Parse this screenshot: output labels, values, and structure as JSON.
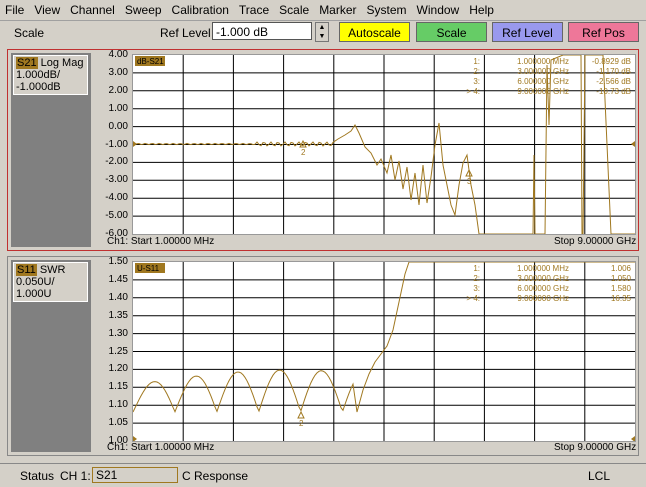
{
  "menu": [
    "File",
    "View",
    "Channel",
    "Sweep",
    "Calibration",
    "Trace",
    "Scale",
    "Marker",
    "System",
    "Window",
    "Help"
  ],
  "toolbar": {
    "section": "Scale",
    "ref_level_label": "Ref Level",
    "ref_level_value": "-1.000 dB",
    "buttons": [
      "Autoscale",
      "Scale",
      "Ref Level",
      "Ref Pos"
    ],
    "button_colors": [
      "#ffff00",
      "#66cc66",
      "#9999ee",
      "#ee7799"
    ]
  },
  "trace_color": "#a07820",
  "upper": {
    "trace_id": "S21",
    "format": "Log Mag",
    "scale": "1.000dB/",
    "ref": "-1.000dB",
    "tag": "dB-S21",
    "y_ticks": [
      "4.00",
      "3.00",
      "2.00",
      "1.00",
      "0.00",
      "-1.00",
      "-2.00",
      "-3.00",
      "-4.00",
      "-5.00",
      "-6.00"
    ],
    "start": "Ch1: Start  1.00000 MHz",
    "stop": "Stop  9.00000 GHz",
    "markers": [
      {
        "id": "1:",
        "freq": "1.000000 MHz",
        "val": "-0.8929 dB"
      },
      {
        "id": "2:",
        "freq": "3.000000 GHz",
        "val": "-1.170 dB"
      },
      {
        "id": "3:",
        "freq": "6.000000 GHz",
        "val": "-2.566 dB"
      },
      {
        "id": "> 4:",
        "freq": "9.000000 GHz",
        "val": "-10.73 dB"
      }
    ]
  },
  "lower": {
    "trace_id": "S11",
    "format": "SWR",
    "scale": "0.050U/",
    "ref": "1.000U",
    "tag": "U-S11",
    "y_ticks": [
      "1.50",
      "1.45",
      "1.40",
      "1.35",
      "1.30",
      "1.25",
      "1.20",
      "1.15",
      "1.10",
      "1.05",
      "1.00"
    ],
    "start": "Ch1: Start  1.00000 MHz",
    "stop": "Stop  9.00000 GHz",
    "markers": [
      {
        "id": "1:",
        "freq": "1.000000 MHz",
        "val": "1.006"
      },
      {
        "id": "2:",
        "freq": "3.000000 GHz",
        "val": "1.050"
      },
      {
        "id": "3:",
        "freq": "6.000000 GHz",
        "val": "1.580"
      },
      {
        "id": "> 4:",
        "freq": "9.000000 GHz",
        "val": "16.35"
      }
    ]
  },
  "status": {
    "label": "Status",
    "channel": "CH 1:",
    "param": "S21",
    "mode": "C  Response",
    "remote": "LCL"
  }
}
